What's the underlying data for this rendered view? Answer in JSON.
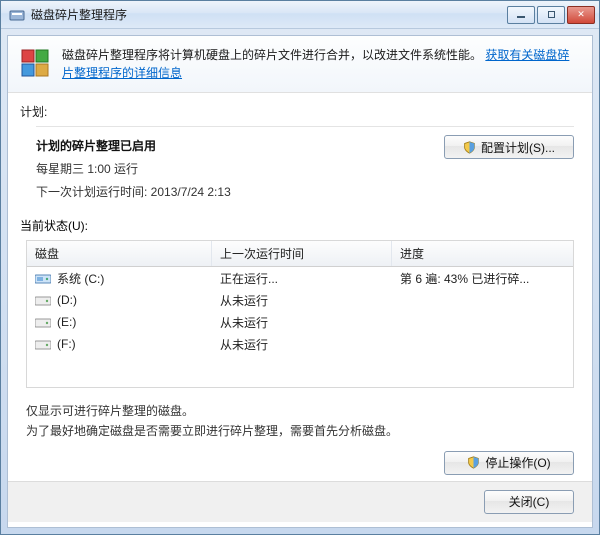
{
  "window": {
    "title": "磁盘碎片整理程序"
  },
  "info": {
    "text_before_link": "磁盘碎片整理程序将计算机硬盘上的碎片文件进行合并，以改进文件系统性能。",
    "link_text": "获取有关磁盘碎片整理程序的详细信息"
  },
  "schedule": {
    "label": "计划:",
    "enabled_heading": "计划的碎片整理已启用",
    "freq": "每星期三  1:00 运行",
    "next_run": "下一次计划运行时间: 2013/7/24 2:13",
    "configure_btn": "配置计划(S)..."
  },
  "status": {
    "label": "当前状态(U):",
    "columns": {
      "disk": "磁盘",
      "last_run": "上一次运行时间",
      "progress": "进度"
    },
    "rows": [
      {
        "name": "系统 (C:)",
        "last_run": "正在运行...",
        "progress": "第 6 遍: 43% 已进行碎...",
        "type": "system"
      },
      {
        "name": "(D:)",
        "last_run": "从未运行",
        "progress": "",
        "type": "hdd"
      },
      {
        "name": "(E:)",
        "last_run": "从未运行",
        "progress": "",
        "type": "hdd"
      },
      {
        "name": "(F:)",
        "last_run": "从未运行",
        "progress": "",
        "type": "hdd"
      }
    ]
  },
  "note": {
    "line1": "仅显示可进行碎片整理的磁盘。",
    "line2": "为了最好地确定磁盘是否需要立即进行碎片整理，需要首先分析磁盘。"
  },
  "buttons": {
    "stop": "停止操作(O)",
    "close": "关闭(C)"
  }
}
